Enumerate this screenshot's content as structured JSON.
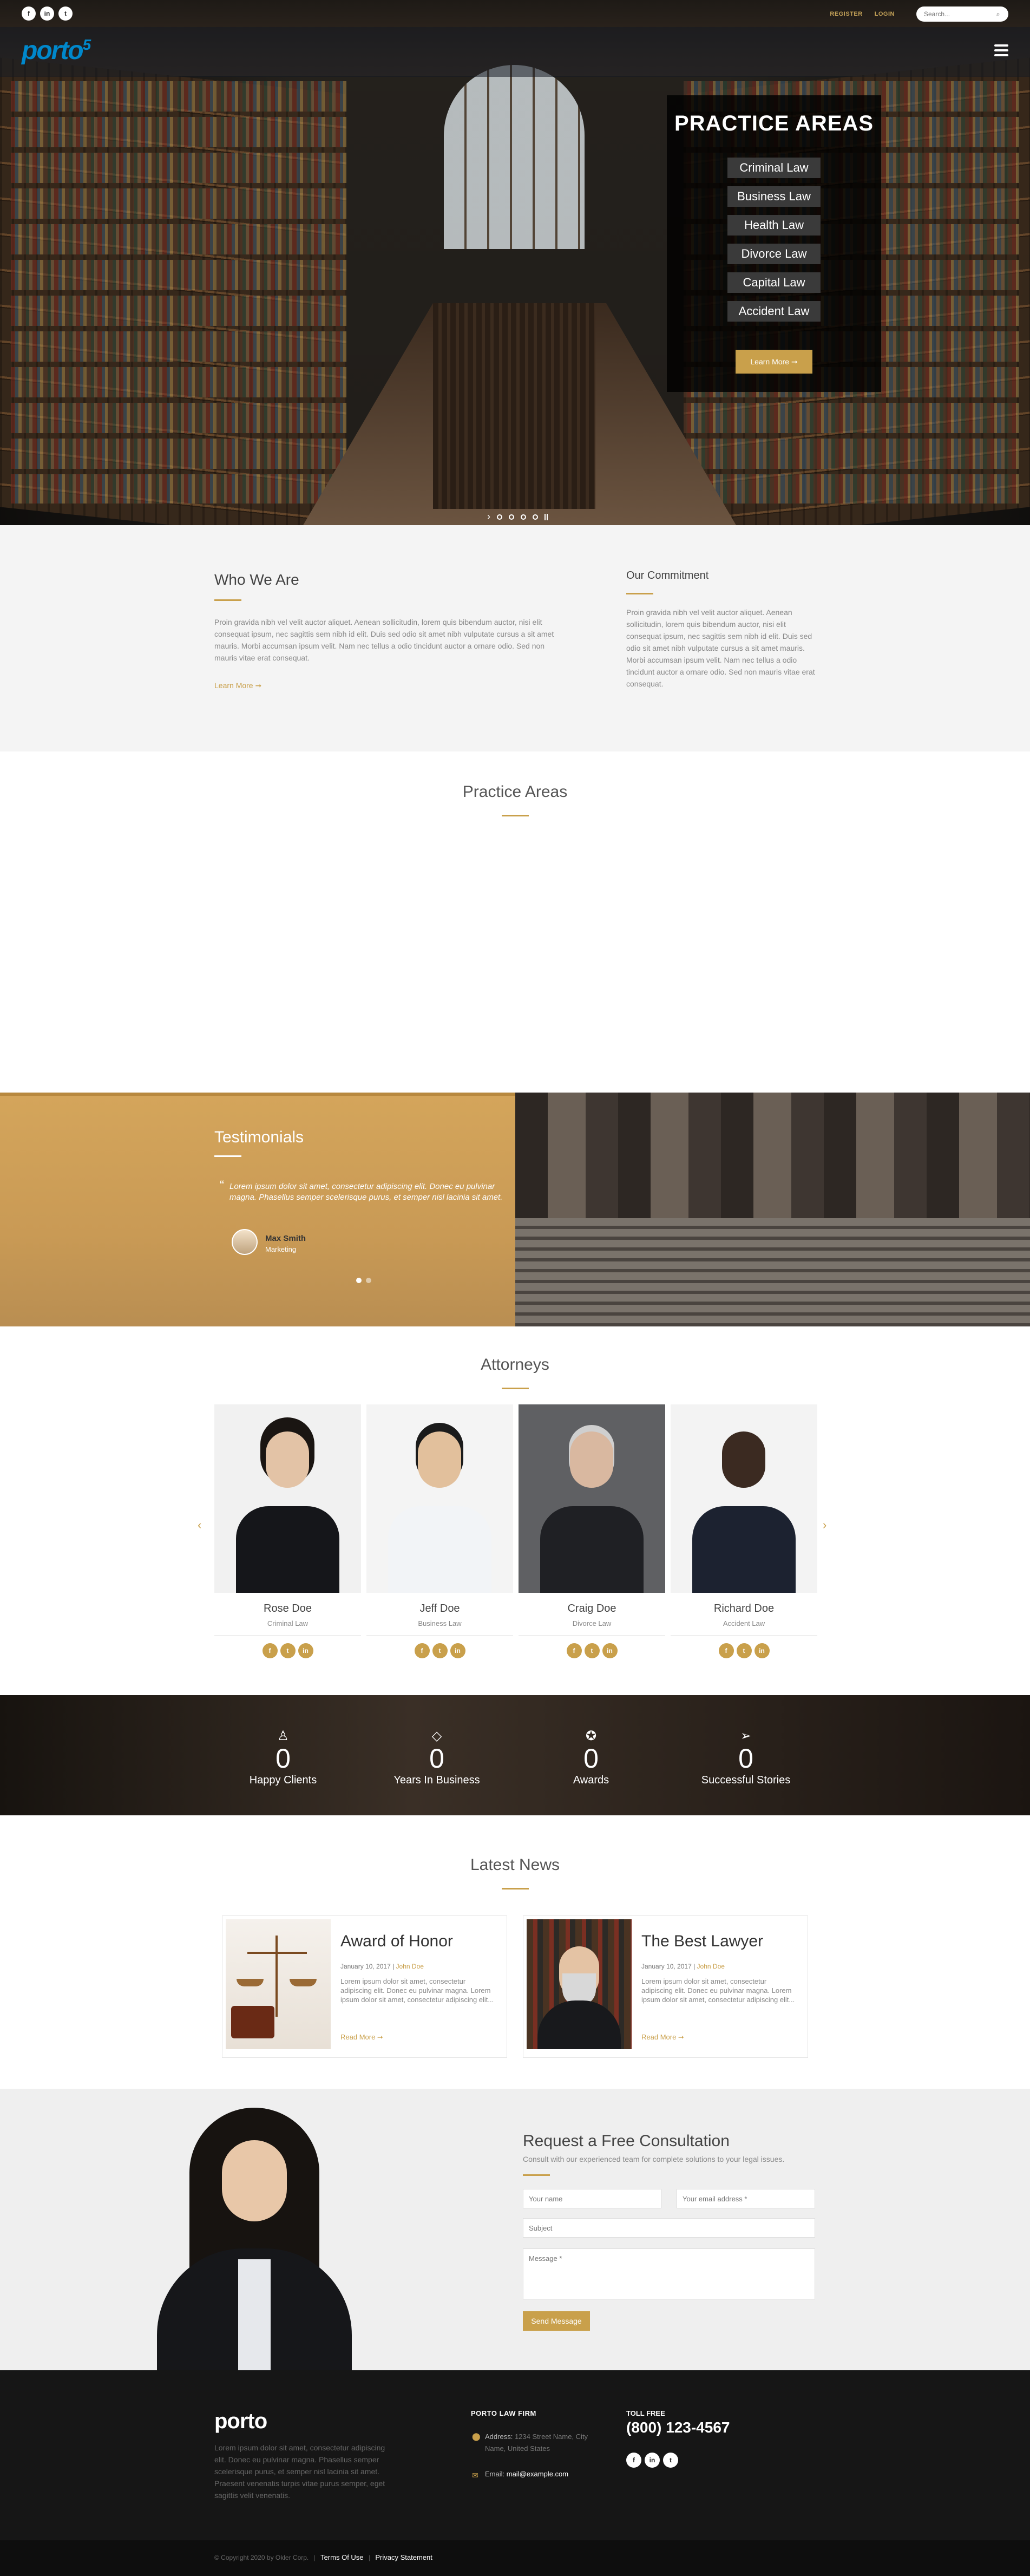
{
  "topbar": {
    "socials": [
      {
        "icon": "facebook-icon",
        "glyph": "f"
      },
      {
        "icon": "linkedin-icon",
        "glyph": "in"
      },
      {
        "icon": "twitter-icon",
        "glyph": "t"
      }
    ],
    "register_label": "REGISTER",
    "login_label": "LOGIN",
    "search_placeholder": "Search..."
  },
  "header": {
    "logo_text": "porto",
    "logo_sup": "5"
  },
  "hero": {
    "practice_title": "PRACTICE AREAS",
    "areas": [
      "Criminal Law",
      "Business Law",
      "Health Law",
      "Divorce Law",
      "Capital Law",
      "Accident Law"
    ],
    "learn_more": "Learn More ➞"
  },
  "about": {
    "who_title": "Who We Are",
    "who_text": "Proin gravida nibh vel velit auctor aliquet. Aenean sollicitudin, lorem quis bibendum auctor, nisi elit consequat ipsum, nec sagittis sem nibh id elit. Duis sed odio sit amet nibh vulputate cursus a sit amet mauris. Morbi accumsan ipsum velit. Nam nec tellus a odio tincidunt auctor a ornare odio. Sed non mauris vitae erat consequat.",
    "read_more": "Learn More ➞",
    "commit_title": "Our Commitment",
    "commit_text": "Proin gravida nibh vel velit auctor aliquet. Aenean sollicitudin, lorem quis bibendum auctor, nisi elit consequat ipsum, nec sagittis sem nibh id elit. Duis sed odio sit amet nibh vulputate cursus a sit amet mauris. Morbi accumsan ipsum velit. Nam nec tellus a odio tincidunt auctor a ornare odio. Sed non mauris vitae erat consequat."
  },
  "practice": {
    "title": "Practice Areas"
  },
  "testimonials": {
    "title": "Testimonials",
    "quote": "Lorem ipsum dolor sit amet, consectetur adipiscing elit. Donec eu pulvinar magna. Phasellus semper scelerisque purus, et semper nisl lacinia sit amet.",
    "author": "Max Smith",
    "role": "Marketing"
  },
  "attorneys": {
    "title": "Attorneys",
    "people": [
      {
        "name": "Rose Doe",
        "role": "Criminal Law"
      },
      {
        "name": "Jeff Doe",
        "role": "Business Law"
      },
      {
        "name": "Craig Doe",
        "role": "Divorce Law"
      },
      {
        "name": "Richard Doe",
        "role": "Accident Law"
      }
    ],
    "prev": "‹",
    "next": "›"
  },
  "counters": [
    {
      "icon": "user-icon",
      "value": "0",
      "label": "Happy Clients"
    },
    {
      "icon": "diamond-icon",
      "value": "0",
      "label": "Years In Business"
    },
    {
      "icon": "award-icon",
      "value": "0",
      "label": "Awards"
    },
    {
      "icon": "send-icon",
      "value": "0",
      "label": "Successful Stories"
    }
  ],
  "news": {
    "title": "Latest News",
    "items": [
      {
        "title": "Award of Honor",
        "date": "January 10, 2017",
        "author": "John Doe",
        "excerpt": "Lorem ipsum dolor sit amet, consectetur adipiscing elit. Donec eu pulvinar magna. Lorem ipsum dolor sit amet, consectetur adipiscing elit...",
        "more": "Read More ➞"
      },
      {
        "title": "The Best Lawyer",
        "date": "January 10, 2017",
        "author": "John Doe",
        "excerpt": "Lorem ipsum dolor sit amet, consectetur adipiscing elit. Donec eu pulvinar magna. Lorem ipsum dolor sit amet, consectetur adipiscing elit...",
        "more": "Read More ➞"
      }
    ]
  },
  "consult": {
    "title": "Request a Free Consultation",
    "subtitle": "Consult with our experienced team for complete solutions to your legal issues.",
    "name_placeholder": "Your name",
    "email_placeholder": "Your email address *",
    "subject_placeholder": "Subject",
    "message_placeholder": "Message *",
    "send_label": "Send Message"
  },
  "footer": {
    "logo_text": "porto",
    "about": "Lorem ipsum dolor sit amet, consectetur adipiscing elit. Donec eu pulvinar magna. Phasellus semper scelerisque purus, et semper nisl lacinia sit amet. Praesent venenatis turpis vitae purus semper, eget sagittis velit venenatis.",
    "firm_title": "PORTO LAW FIRM",
    "address_label": "Address:",
    "address_value": "1234 Street Name, City Name, United States",
    "email_label": "Email:",
    "email_value": "mail@example.com",
    "toll_label": "TOLL FREE",
    "phone": "(800) 123-4567",
    "socials": [
      {
        "icon": "facebook-icon",
        "glyph": "f"
      },
      {
        "icon": "linkedin-icon",
        "glyph": "in"
      },
      {
        "icon": "twitter-icon",
        "glyph": "t"
      }
    ],
    "copyright": "© Copyright 2020 by Okler Corp.",
    "terms": "Terms Of Use",
    "privacy": "Privacy Statement"
  },
  "colors": {
    "accent": "#c9a04b",
    "logo": "#0088cc",
    "footer_bg": "#161616"
  }
}
